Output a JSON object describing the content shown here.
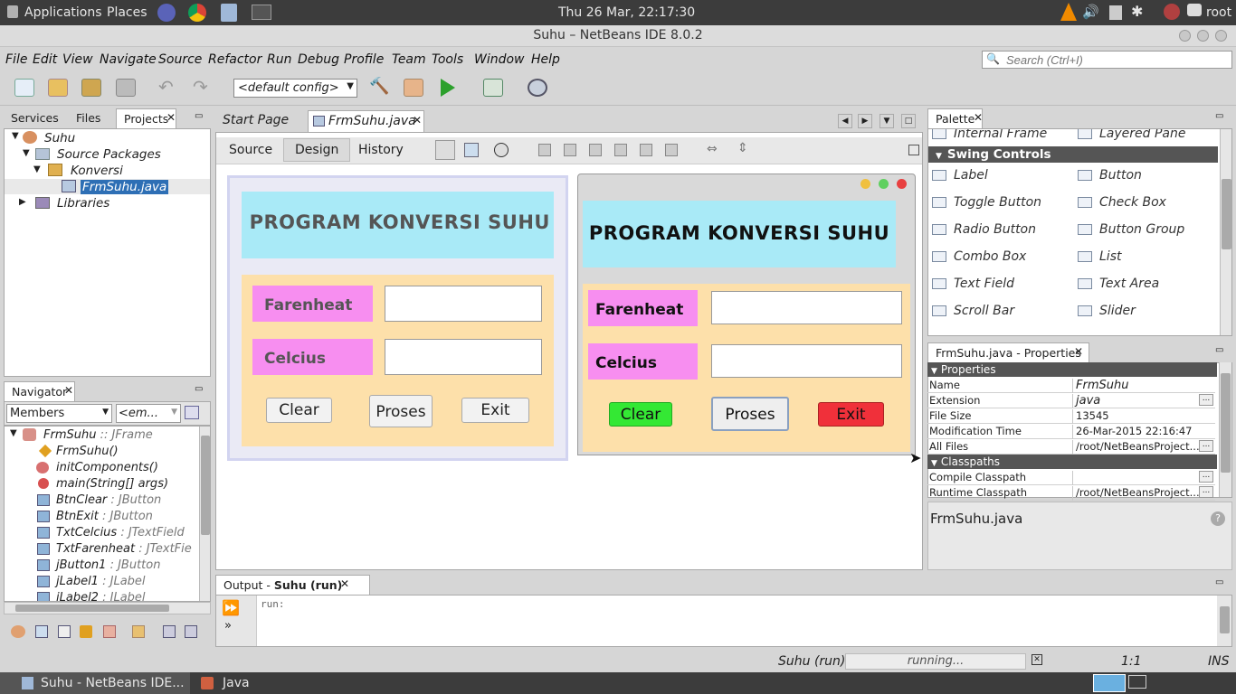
{
  "topbar": {
    "applications": "Applications",
    "places": "Places",
    "clock": "Thu 26 Mar, 22:17:30",
    "user": "root"
  },
  "window_title": "Suhu – NetBeans IDE 8.0.2",
  "menu": [
    "File",
    "Edit",
    "View",
    "Navigate",
    "Source",
    "Refactor",
    "Run",
    "Debug",
    "Profile",
    "Team",
    "Tools",
    "Window",
    "Help"
  ],
  "search": {
    "placeholder": "Search (Ctrl+I)"
  },
  "toolbar": {
    "config": "<default config>"
  },
  "projects_tabs": [
    "Services",
    "Files",
    "Projects"
  ],
  "tree": {
    "project": "Suhu",
    "source_packages": "Source Packages",
    "package": "Konversi",
    "file": "FrmSuhu.java",
    "libraries": "Libraries"
  },
  "editor_tabs": [
    "Start Page",
    "FrmSuhu.java"
  ],
  "editor_subtabs": [
    "Source",
    "Design",
    "History"
  ],
  "form": {
    "title": "PROGRAM KONVERSI SUHU",
    "label1": "Farenheat",
    "label2": "Celcius",
    "btn_clear": "Clear",
    "btn_proses": "Proses",
    "btn_exit": "Exit"
  },
  "navigator": {
    "title": "Navigator",
    "members": "Members",
    "filter": "<em...",
    "items": [
      {
        "name": "FrmSuhu",
        "type": " :: JFrame"
      },
      {
        "name": "FrmSuhu()",
        "type": ""
      },
      {
        "name": "initComponents()",
        "type": ""
      },
      {
        "name": "main(String[] args)",
        "type": ""
      },
      {
        "name": "BtnClear",
        "type": " : JButton"
      },
      {
        "name": "BtnExit",
        "type": " : JButton"
      },
      {
        "name": "TxtCelcius",
        "type": " : JTextField"
      },
      {
        "name": "TxtFarenheat",
        "type": " : JTextFie"
      },
      {
        "name": "jButton1",
        "type": " : JButton"
      },
      {
        "name": "jLabel1",
        "type": " : JLabel"
      },
      {
        "name": "jLabel2",
        "type": " : JLabel"
      }
    ]
  },
  "palette": {
    "title": "Palette",
    "internal_frame": "Internal Frame",
    "layered_pane": "Layered Pane",
    "section": "Swing Controls",
    "items": [
      "Label",
      "Button",
      "Toggle Button",
      "Check Box",
      "Radio Button",
      "Button Group",
      "Combo Box",
      "List",
      "Text Field",
      "Text Area",
      "Scroll Bar",
      "Slider"
    ]
  },
  "properties": {
    "title": "FrmSuhu.java - Properties",
    "section1": "Properties",
    "section2": "Classpaths",
    "rows": [
      {
        "k": "Name",
        "v": "FrmSuhu"
      },
      {
        "k": "Extension",
        "v": "java"
      },
      {
        "k": "File Size",
        "v": "13545"
      },
      {
        "k": "Modification Time",
        "v": "26-Mar-2015 22:16:47"
      },
      {
        "k": "All Files",
        "v": "/root/NetBeansProject..."
      }
    ],
    "cp_rows": [
      {
        "k": "Compile Classpath",
        "v": ""
      },
      {
        "k": "Runtime Classpath",
        "v": "/root/NetBeansProject..."
      }
    ],
    "footer": "FrmSuhu.java"
  },
  "output": {
    "title": "Output - ",
    "title_bold": "Suhu (run)",
    "text": "run:"
  },
  "status": {
    "task": "Suhu (run)",
    "progress": "running...",
    "position": "1:1",
    "mode": "INS"
  },
  "taskbar": {
    "item1": "Suhu - NetBeans IDE...",
    "item2": "Java"
  },
  "colors": {
    "form_title_bg": "#a9eaf7",
    "form_panel_bg": "#fde0aa",
    "label_bg": "#f78ef0",
    "clear_green": "#34e834",
    "exit_red": "#f0303a",
    "selection": "#2e6fb5"
  }
}
